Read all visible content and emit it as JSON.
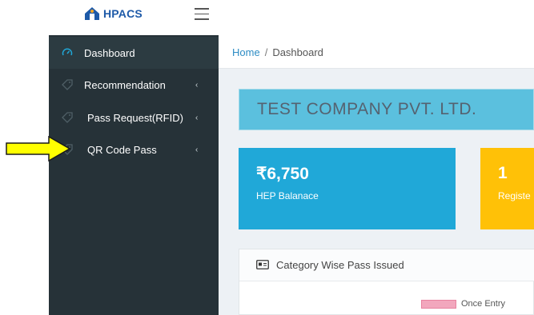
{
  "header": {
    "logo_text": "HPACS",
    "menu_icon": "hamburger-icon"
  },
  "sidebar": {
    "items": [
      {
        "label": "Dashboard",
        "icon": "speedometer-icon",
        "active": true,
        "has_submenu": false
      },
      {
        "label": "Recommendation",
        "icon": "tag-icon",
        "active": false,
        "has_submenu": true
      },
      {
        "label": "Pass Request(RFID)",
        "icon": "tag-icon",
        "active": false,
        "has_submenu": true
      },
      {
        "label": "QR Code Pass",
        "icon": "tag-icon",
        "active": false,
        "has_submenu": true
      }
    ],
    "chevron": "‹"
  },
  "breadcrumb": {
    "home": "Home",
    "separator": "/",
    "current": "Dashboard"
  },
  "company": {
    "name": "TEST COMPANY PVT. LTD."
  },
  "stats": [
    {
      "value": "₹6,750",
      "label": "HEP Balanace",
      "color": "#20a8d8"
    },
    {
      "value": "1",
      "label": "Registe",
      "color": "#ffc107"
    }
  ],
  "category_card": {
    "title": "Category Wise Pass Issued",
    "legend": [
      {
        "label": "Once Entry",
        "color": "#f2a7bd"
      }
    ]
  },
  "annotation": {
    "arrow_color": "#ffff00",
    "points_to": "QR Code Pass"
  },
  "colors": {
    "sidebar_bg": "#263238",
    "active_icon": "#20a8d8",
    "link": "#2d8cc4"
  }
}
